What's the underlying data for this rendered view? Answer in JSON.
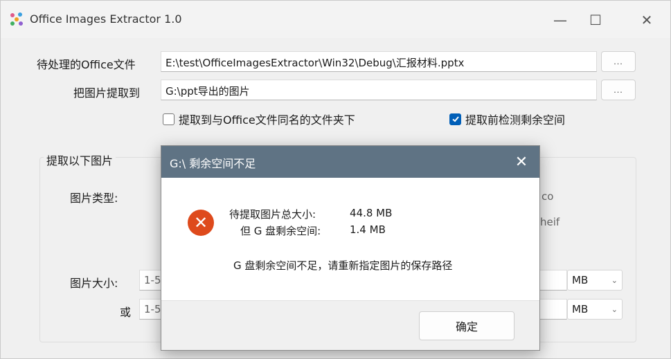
{
  "window": {
    "title": "Office Images Extractor 1.0",
    "minimize_glyph": "—",
    "maximize_glyph": "☐",
    "close_glyph": "✕"
  },
  "source": {
    "label": "待处理的Office文件",
    "value": "E:\\test\\OfficeImagesExtractor\\Win32\\Debug\\汇报材料.pptx",
    "browse_label": "..."
  },
  "dest": {
    "label": "把图片提取到",
    "value": "G:\\ppt导出的图片",
    "browse_label": "..."
  },
  "options": {
    "same_folder": {
      "label": "提取到与Office文件同名的文件夹下",
      "checked": false
    },
    "check_space": {
      "label": "提取前检测剩余空间",
      "checked": true
    }
  },
  "group": {
    "title": "提取以下图片",
    "type_label": "图片类型:",
    "type_fragment_1": "co",
    "type_fragment_2": "heif",
    "size_label": "图片大小:",
    "size_value": "1-5",
    "size_unit": "MB",
    "or_label": "或",
    "or_value": "1-5",
    "or_unit": "MB"
  },
  "dialog": {
    "title": "G:\\ 剩余空间不足",
    "close_glyph": "✕",
    "icon": "error-icon",
    "total_label": "待提取图片总大小:",
    "total_value": "44.8 MB",
    "free_label": "但 G 盘剩余空间:",
    "free_value": "1.4 MB",
    "message": "G 盘剩余空间不足，请重新指定图片的保存路径",
    "ok_label": "确定"
  },
  "colors": {
    "accent": "#005fb8",
    "dialog_title_bg": "#5f7384",
    "error": "#de4a1c"
  }
}
